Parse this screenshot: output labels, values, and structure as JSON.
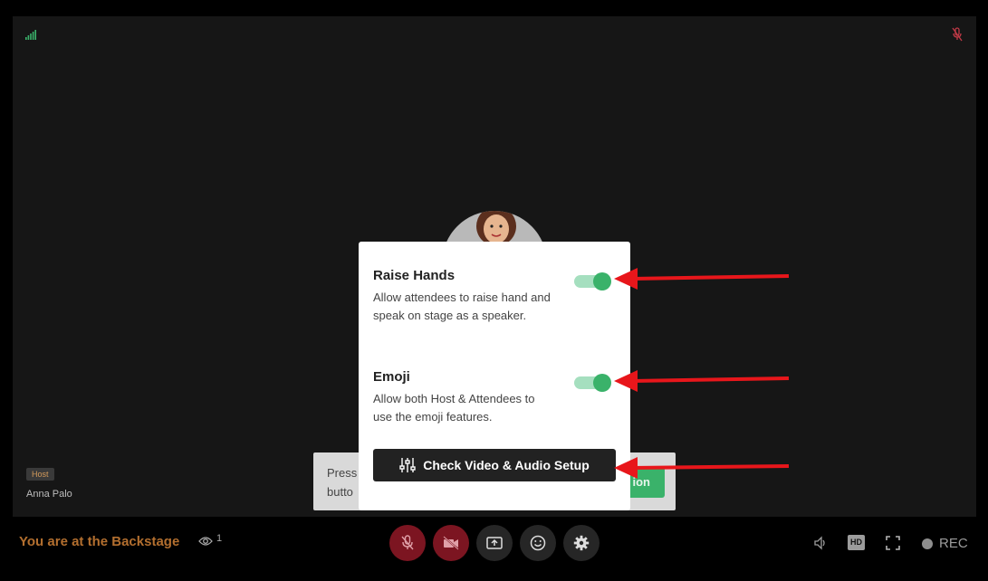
{
  "stage": {
    "host_badge": "Host",
    "host_name": "Anna Palo",
    "tooltip_text_line1": "Press",
    "tooltip_text_line2": "butto",
    "tooltip_button": "ion"
  },
  "modal": {
    "raise_hands": {
      "title": "Raise Hands",
      "description": "Allow attendees to raise hand and speak on stage as a speaker.",
      "enabled": true
    },
    "emoji": {
      "title": "Emoji",
      "description": "Allow both Host & Attendees to use the emoji features.",
      "enabled": true
    },
    "check_button": "Check Video & Audio Setup"
  },
  "bottom_bar": {
    "status": "You are at the Backstage",
    "viewer_count": "1",
    "hd_label": "HD",
    "rec_label": "REC"
  },
  "colors": {
    "accent_green": "#3ab26a",
    "muted_red": "#7c1521",
    "status_orange": "#b36f2f",
    "annotation_red": "#e8161b"
  }
}
